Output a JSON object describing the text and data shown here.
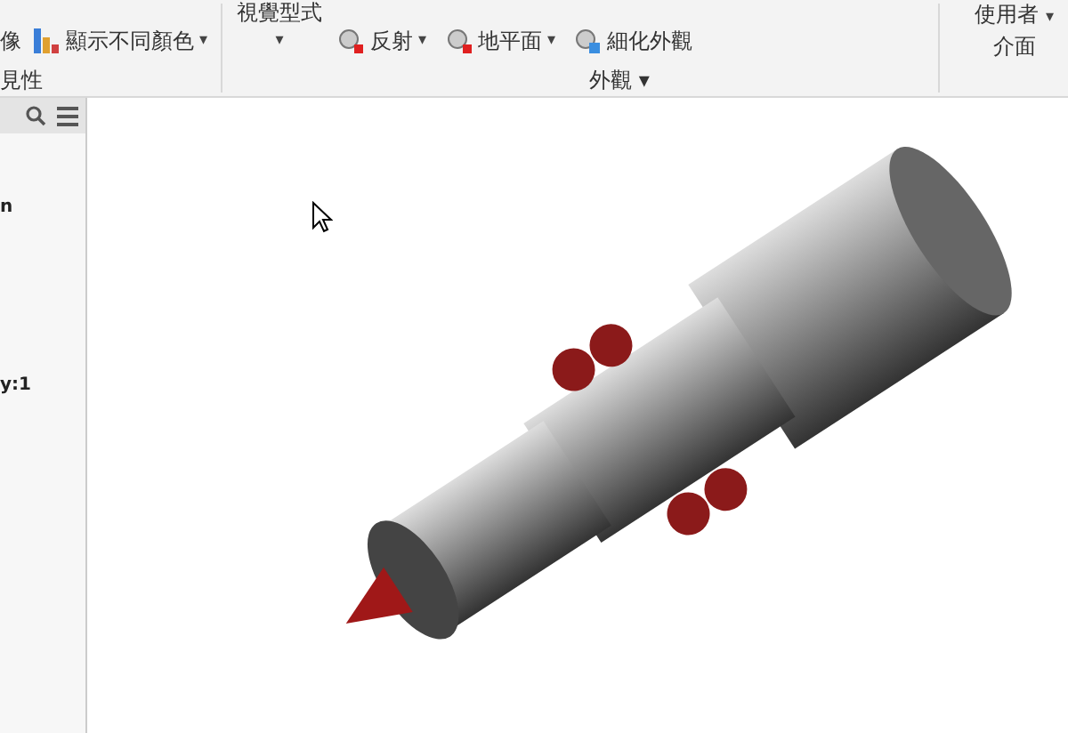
{
  "ribbon": {
    "left_group": {
      "cut_label": "像",
      "color_button": "顯示不同顏色",
      "caret": "▾",
      "group_label": "見性"
    },
    "visual_style": {
      "label": "視覺型式",
      "caret": "▾"
    },
    "appearance": {
      "buttons": [
        {
          "label": "反射",
          "caret": "▾"
        },
        {
          "label": "地平面",
          "caret": "▾"
        },
        {
          "label": "細化外觀"
        }
      ],
      "group_label": "外觀",
      "caret": "▾"
    },
    "user_interface": {
      "label_line1": "使用者",
      "label_line2": "介面",
      "caret": "▾"
    }
  },
  "browser_panel": {
    "rows": [
      "n",
      "y:1"
    ]
  }
}
